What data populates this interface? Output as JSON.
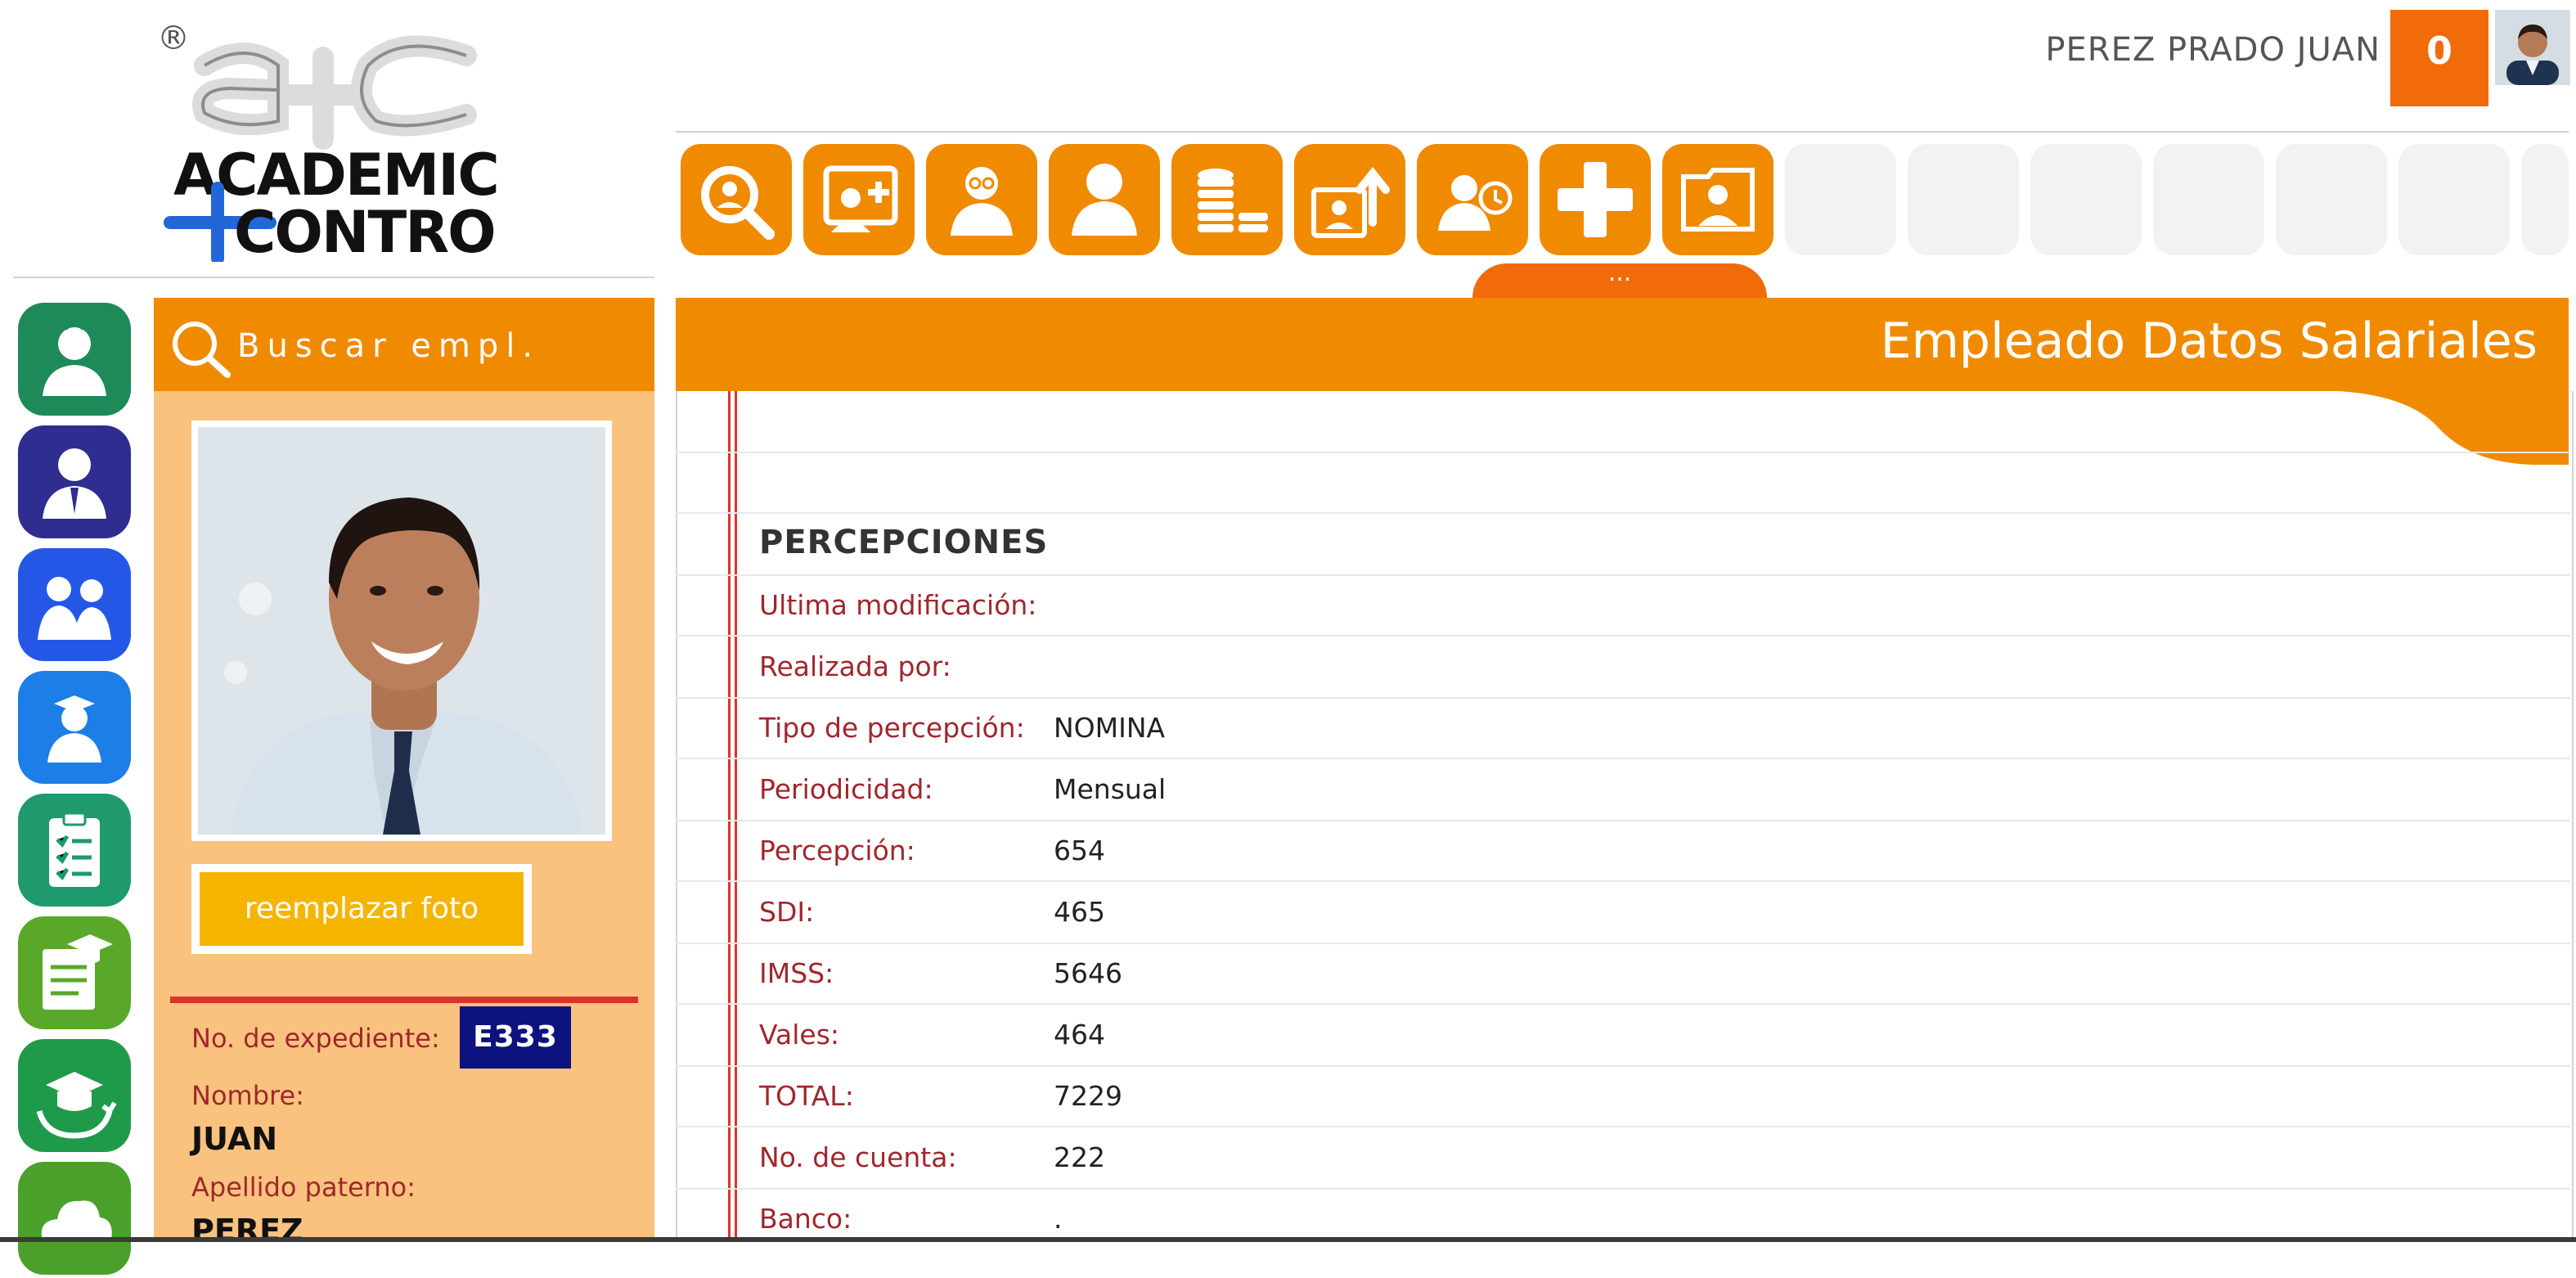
{
  "brand": {
    "logo_text_1": "ACADEMIC",
    "logo_text_2": "CONTROL",
    "registered": "®"
  },
  "header": {
    "user_name": "PEREZ PRADO JUAN",
    "notification_count": "0"
  },
  "toolbar": {
    "buttons": [
      {
        "icon": "search-person-icon"
      },
      {
        "icon": "add-employee-icon"
      },
      {
        "icon": "employee-profile-icon"
      },
      {
        "icon": "person-icon"
      },
      {
        "icon": "coins-icon"
      },
      {
        "icon": "upload-person-icon"
      },
      {
        "icon": "person-history-icon"
      },
      {
        "icon": "plus-icon"
      },
      {
        "icon": "photo-person-icon"
      }
    ],
    "more_label": "..."
  },
  "sidebar": {
    "items": [
      {
        "icon": "teacher-icon",
        "color": "#1e8a5a"
      },
      {
        "icon": "employee-icon",
        "color": "#2f2d8f"
      },
      {
        "icon": "parents-icon",
        "color": "#2557e6"
      },
      {
        "icon": "student-icon",
        "color": "#1c7ee6"
      },
      {
        "icon": "clipboard-icon",
        "color": "#1e9a6c"
      },
      {
        "icon": "certificate-icon",
        "color": "#5aa82a"
      },
      {
        "icon": "graduation-cycle-icon",
        "color": "#1f9a4a"
      },
      {
        "icon": "cloud-icon",
        "color": "#4aa02a"
      }
    ]
  },
  "profile": {
    "search_label": "Buscar empl.",
    "replace_photo_label": "reemplazar foto",
    "expediente_label": "No. de expediente:",
    "expediente_value": "E333",
    "nombre_label": "Nombre:",
    "nombre_value": "JUAN",
    "apellido_label": "Apellido paterno:",
    "apellido_value": "PEREZ"
  },
  "main": {
    "title": "Empleado Datos Salariales",
    "section_title": "PERCEPCIONES",
    "fields": [
      {
        "label": "Ultima modificación:",
        "value": ""
      },
      {
        "label": "Realizada por:",
        "value": ""
      },
      {
        "label": "Tipo de percepción:",
        "value": "NOMINA"
      },
      {
        "label": "Periodicidad:",
        "value": "Mensual"
      },
      {
        "label": "Percepción:",
        "value": "654"
      },
      {
        "label": "SDI:",
        "value": "465"
      },
      {
        "label": "IMSS:",
        "value": "5646"
      },
      {
        "label": "Vales:",
        "value": "464"
      },
      {
        "label": "TOTAL:",
        "value": "7229"
      },
      {
        "label": "No. de cuenta:",
        "value": "222"
      },
      {
        "label": "Banco:",
        "value": "."
      }
    ]
  },
  "colors": {
    "orange": "#f08a00",
    "panel": "#f9c27f",
    "label_red": "#a0272d",
    "badge_blue": "#0c127e",
    "notif": "#f26b0a",
    "button_yellow": "#f5b400"
  }
}
